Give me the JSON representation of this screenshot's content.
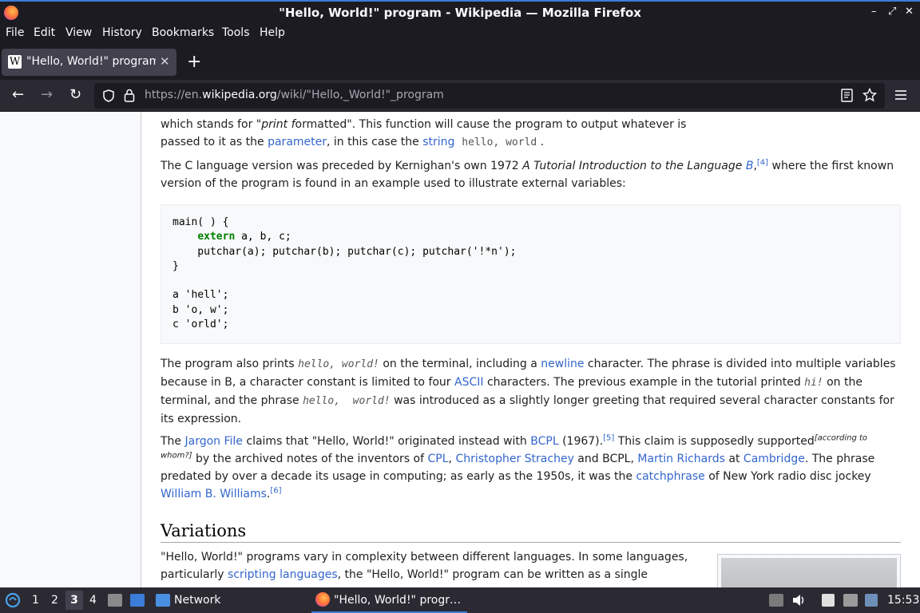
{
  "window": {
    "title": "\"Hello, World!\" program - Wikipedia — Mozilla Firefox",
    "minimize": "–",
    "maximize": "⤢",
    "close": "✕"
  },
  "menu": [
    "File",
    "Edit",
    "View",
    "History",
    "Bookmarks",
    "Tools",
    "Help"
  ],
  "tab": {
    "label": "\"Hello, World!\" program",
    "favicon": "W",
    "close": "✕",
    "new_tab": "+"
  },
  "nav": {
    "url_prefix": "https://en.",
    "url_domain": "wikipedia.org",
    "url_path": "/wiki/\"Hello,_World!\"_program",
    "back_icon": "←",
    "forward_icon": "→",
    "reload_icon": "↻"
  },
  "article": {
    "p1_line1_a": "which stands for \"",
    "p1_line1_print": "print f",
    "p1_line1_b": "ormatted\". This function will cause the program to output whatever is",
    "p1_line2_a": "passed to it as the ",
    "p1_link_parameter": "parameter",
    "p1_line2_b": ", in this case the ",
    "p1_link_string": "string",
    "p1_code": "hello, world",
    "p1_end": ".",
    "p2_a": "The C language version was preceded by Kernighan's own 1972 ",
    "p2_italic": "A Tutorial Introduction to the Language ",
    "p2_link_b": "B",
    "p2_comma": ",",
    "p2_ref": "[4]",
    "p2_b": " where the first known version of the program is found in an example used to illustrate external variables:",
    "code_l1": "main( ) {",
    "code_l2_kw": "extern",
    "code_l2_rest": " a, b, c;",
    "code_l3": "    putchar(a); putchar(b); putchar(c); putchar('!*n');",
    "code_l4": "}",
    "code_l6": "a 'hell';",
    "code_l7": "b 'o, w';",
    "code_l8": "c 'orld';",
    "p3_a": "The program also prints ",
    "p3_code1": "hello, world!",
    "p3_b": " on the terminal, including a ",
    "p3_link_newline": "newline",
    "p3_c": " character. The phrase is divided into multiple variables because in B, a character constant is limited to four ",
    "p3_link_ascii": "ASCII",
    "p3_d": " characters. The previous example in the tutorial printed ",
    "p3_code2": "hi!",
    "p3_e": " on the terminal, and the phrase ",
    "p3_code3": "hello,  world!",
    "p3_f": " was introduced as a slightly longer greeting that required several character constants for its expression.",
    "p4_a": "The ",
    "p4_link_jargon": "Jargon File",
    "p4_b": " claims that \"Hello, World!\" originated instead with ",
    "p4_link_bcpl": "BCPL",
    "p4_c": " (1967).",
    "p4_ref5": "[5]",
    "p4_d": " This claim is supposedly supported",
    "p4_whom": "[according to whom?]",
    "p4_e": " by the archived notes of the inventors of ",
    "p4_link_cpl": "CPL",
    "p4_comma": ", ",
    "p4_link_strachey": "Christopher Strachey",
    "p4_f": " and BCPL, ",
    "p4_link_richards": "Martin Richards",
    "p4_g": " at ",
    "p4_link_cambridge": "Cambridge",
    "p4_h": ". The phrase predated by over a decade its usage in computing; as early as the 1950s, it was the ",
    "p4_link_catchphrase": "catchphrase",
    "p4_i": " of New York radio disc jockey ",
    "p4_link_williams": "William B. Williams",
    "p4_j": ".",
    "p4_ref6": "[6]",
    "heading_variations": "Variations",
    "p5_a": "\"Hello, World!\" programs vary in complexity between different languages. In some languages,",
    "p5_b": "particularly ",
    "p5_link_scripting": "scripting languages",
    "p5_c": ", the \"Hello, World!\" program can be written as a single"
  },
  "taskbar": {
    "workspaces": [
      "1",
      "2",
      "3",
      "4"
    ],
    "active_workspace": "3",
    "network_label": "Network",
    "window_label": "\"Hello, World!\" progr…",
    "clock": "15:53"
  },
  "colors": {
    "link": "#3366cc",
    "titlebar": "#1c1b22",
    "accent": "#3b7dd8"
  }
}
